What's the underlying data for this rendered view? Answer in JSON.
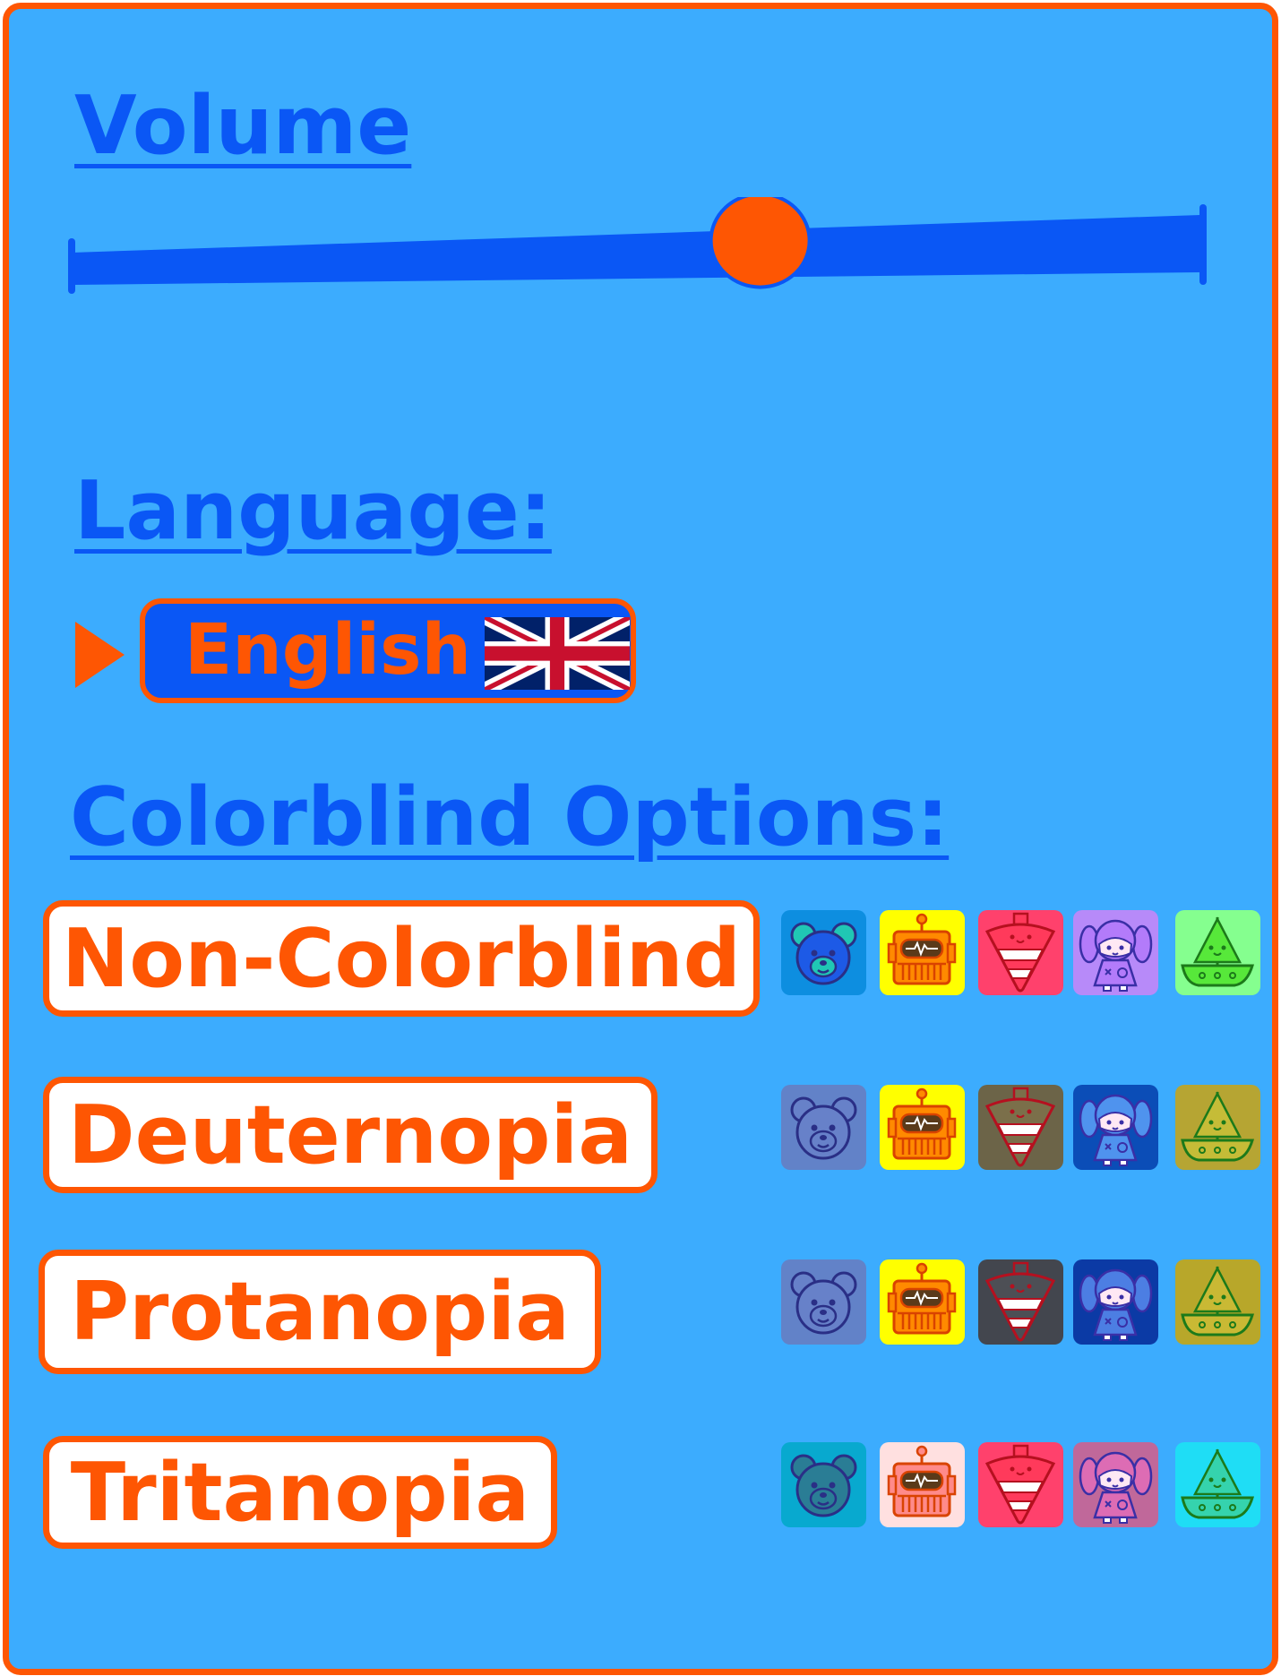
{
  "volume": {
    "label": "Volume",
    "level": 0.61
  },
  "language": {
    "label": "Language:",
    "selected": "English",
    "flag_icon": "uk-flag-icon"
  },
  "colorblind": {
    "label": "Colorblind Options:",
    "options": [
      {
        "label": "Non-Colorblind",
        "bear": {
          "bg": "#0d8ee0",
          "face": "#1d5ae6",
          "ear": "#20c7b4"
        },
        "robot": {
          "bg": "#ffff00",
          "body": "#ff8a00"
        },
        "top": {
          "bg": "#ff416c",
          "body": "#ff3a5b"
        },
        "doll": {
          "bg": "#b78af9",
          "hair": "#b37bfa"
        },
        "boat": {
          "bg": "#85ff8f",
          "hull": "#57e83a"
        }
      },
      {
        "label": "Deuternopia",
        "bear": {
          "bg": "#6282c8",
          "face": "#6781c9",
          "ear": "#6781c9"
        },
        "robot": {
          "bg": "#ffff00",
          "body": "#ff8a00"
        },
        "top": {
          "bg": "#6c6448",
          "body": "#7b6f4a"
        },
        "doll": {
          "bg": "#0b4db7",
          "hair": "#4f93ee"
        },
        "boat": {
          "bg": "#b6a533",
          "hull": "#c5bc37"
        }
      },
      {
        "label": "Protanopia",
        "bear": {
          "bg": "#6282c8",
          "face": "#6781c9",
          "ear": "#6781c9"
        },
        "robot": {
          "bg": "#ffff00",
          "body": "#ff8a00"
        },
        "top": {
          "bg": "#43464e",
          "body": "#4d4f55"
        },
        "doll": {
          "bg": "#0b3aa5",
          "hair": "#4c7ee3"
        },
        "boat": {
          "bg": "#b8a72a",
          "hull": "#c9b934"
        }
      },
      {
        "label": "Tritanopia",
        "bear": {
          "bg": "#08a9cf",
          "face": "#2a7d95",
          "ear": "#2a7d95"
        },
        "robot": {
          "bg": "#ffe0e0",
          "body": "#ff8a8a"
        },
        "top": {
          "bg": "#ff416c",
          "body": "#ff3a5b"
        },
        "doll": {
          "bg": "#c0689a",
          "hair": "#dd6cb4"
        },
        "boat": {
          "bg": "#1fddf5",
          "hull": "#35d3ad"
        }
      }
    ]
  }
}
